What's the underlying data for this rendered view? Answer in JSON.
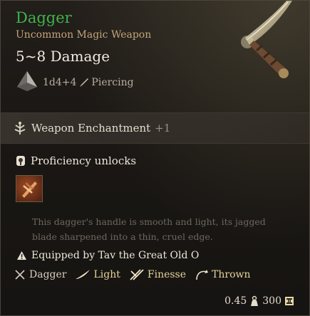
{
  "item": {
    "name": "Dagger",
    "subtitle": "Uncommon Magic Weapon",
    "damage": "5~8 Damage",
    "dice": "1d4+4",
    "damage_type": "Piercing"
  },
  "enchantment": {
    "label": "Weapon Enchantment",
    "bonus": "+1"
  },
  "proficiency": {
    "label": "Proficiency unlocks"
  },
  "description": "This dagger's handle is smooth and light, its jagged blade sharpened into a thin, cruel edge.",
  "equipped": {
    "label": "Equipped by Tav the Great Old O"
  },
  "properties": [
    {
      "label": "Dagger"
    },
    {
      "label": "Light"
    },
    {
      "label": "Finesse"
    },
    {
      "label": "Thrown"
    }
  ],
  "footer": {
    "weight": "0.45",
    "value": "300"
  },
  "colors": {
    "uncommon_green": "#3fb34a",
    "subtitle_tan": "#c4a57a",
    "property_gold": "#e4d49a"
  }
}
